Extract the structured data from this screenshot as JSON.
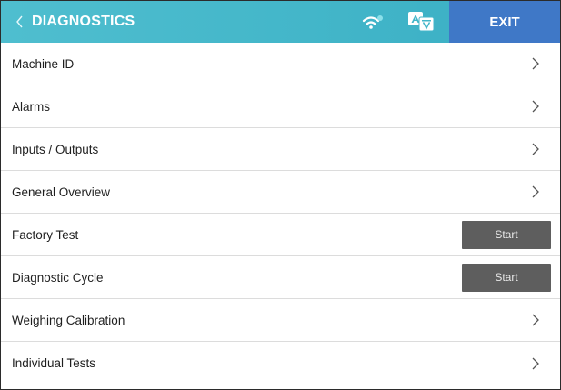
{
  "header": {
    "back_icon": "chevron-left-icon",
    "title": "DIAGNOSTICS",
    "wifi_icon": "wifi-icon",
    "language_icon": "translate-icon",
    "exit_label": "EXIT",
    "colors": {
      "header_bg": "#43b6c9",
      "exit_bg": "#3f78c7",
      "text": "#ffffff"
    }
  },
  "menu": {
    "items": [
      {
        "label": "Machine ID",
        "action": "chevron"
      },
      {
        "label": "Alarms",
        "action": "chevron"
      },
      {
        "label": "Inputs / Outputs",
        "action": "chevron"
      },
      {
        "label": "General Overview",
        "action": "chevron"
      },
      {
        "label": "Factory Test",
        "action": "button",
        "button_label": "Start"
      },
      {
        "label": "Diagnostic Cycle",
        "action": "button",
        "button_label": "Start"
      },
      {
        "label": "Weighing Calibration",
        "action": "chevron"
      },
      {
        "label": "Individual Tests",
        "action": "chevron"
      }
    ],
    "start_button_color": "#5e5e5e"
  }
}
